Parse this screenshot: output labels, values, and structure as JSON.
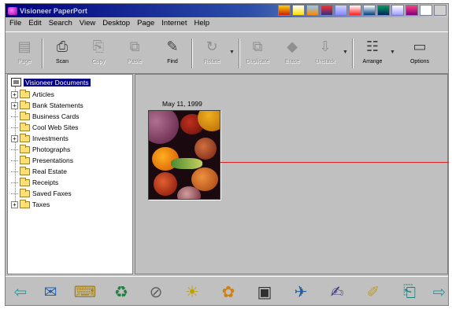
{
  "window": {
    "title": "Visioneer PaperPort"
  },
  "menu": [
    "File",
    "Edit",
    "Search",
    "View",
    "Desktop",
    "Page",
    "Internet",
    "Help"
  ],
  "toolbar": {
    "buttons": [
      {
        "label": "Page",
        "glyph": "▤",
        "enabled": false
      },
      {
        "label": "Scan",
        "glyph": "⎙",
        "enabled": true
      },
      {
        "label": "Copy",
        "glyph": "⎘",
        "enabled": false
      },
      {
        "label": "Paste",
        "glyph": "⧉",
        "enabled": false
      },
      {
        "label": "Find",
        "glyph": "✎",
        "enabled": true
      },
      {
        "label": "Rotate",
        "glyph": "↻",
        "enabled": false
      },
      {
        "label": "Duplicate",
        "glyph": "⧉",
        "enabled": false
      },
      {
        "label": "Erase",
        "glyph": "◆",
        "enabled": false
      },
      {
        "label": "Unstack",
        "glyph": "⇩",
        "enabled": false
      },
      {
        "label": "Arrange",
        "glyph": "☷",
        "enabled": true
      },
      {
        "label": "Options",
        "glyph": "▭",
        "enabled": true
      }
    ]
  },
  "tree": {
    "root": "Visioneer Documents",
    "items": [
      {
        "label": "Articles",
        "expandable": true
      },
      {
        "label": "Bank Statements",
        "expandable": true
      },
      {
        "label": "Business Cards",
        "expandable": false
      },
      {
        "label": "Cool Web Sites",
        "expandable": false
      },
      {
        "label": "Investments",
        "expandable": true
      },
      {
        "label": "Photographs",
        "expandable": false
      },
      {
        "label": "Presentations",
        "expandable": false
      },
      {
        "label": "Real Estate",
        "expandable": false
      },
      {
        "label": "Receipts",
        "expandable": false
      },
      {
        "label": "Saved Faxes",
        "expandable": false
      },
      {
        "label": "Taxes",
        "expandable": true
      }
    ]
  },
  "content": {
    "document": {
      "date": "May 11, 1999"
    }
  },
  "bottombar": {
    "icons": [
      {
        "name": "scroll-left-arrow-icon",
        "glyph": "⇦"
      },
      {
        "name": "fax-icon",
        "glyph": "✉"
      },
      {
        "name": "print-icon",
        "glyph": "⌨"
      },
      {
        "name": "recycle-icon",
        "glyph": "♻"
      },
      {
        "name": "paperclip-icon",
        "glyph": "⊘"
      },
      {
        "name": "image-editor-icon",
        "glyph": "☀"
      },
      {
        "name": "paint-icon",
        "glyph": "✿"
      },
      {
        "name": "photo-icon",
        "glyph": "▣"
      },
      {
        "name": "email-icon",
        "glyph": "✈"
      },
      {
        "name": "ocr-icon",
        "glyph": "✍"
      },
      {
        "name": "notepad-icon",
        "glyph": "✐"
      },
      {
        "name": "document-icon",
        "glyph": "⎗"
      },
      {
        "name": "scroll-right-arrow-icon",
        "glyph": "⇨"
      }
    ]
  },
  "colors": {
    "titlebar": "#000080",
    "selection": "#000080",
    "link_line": "#e02020",
    "chrome": "#c0c0c0"
  }
}
